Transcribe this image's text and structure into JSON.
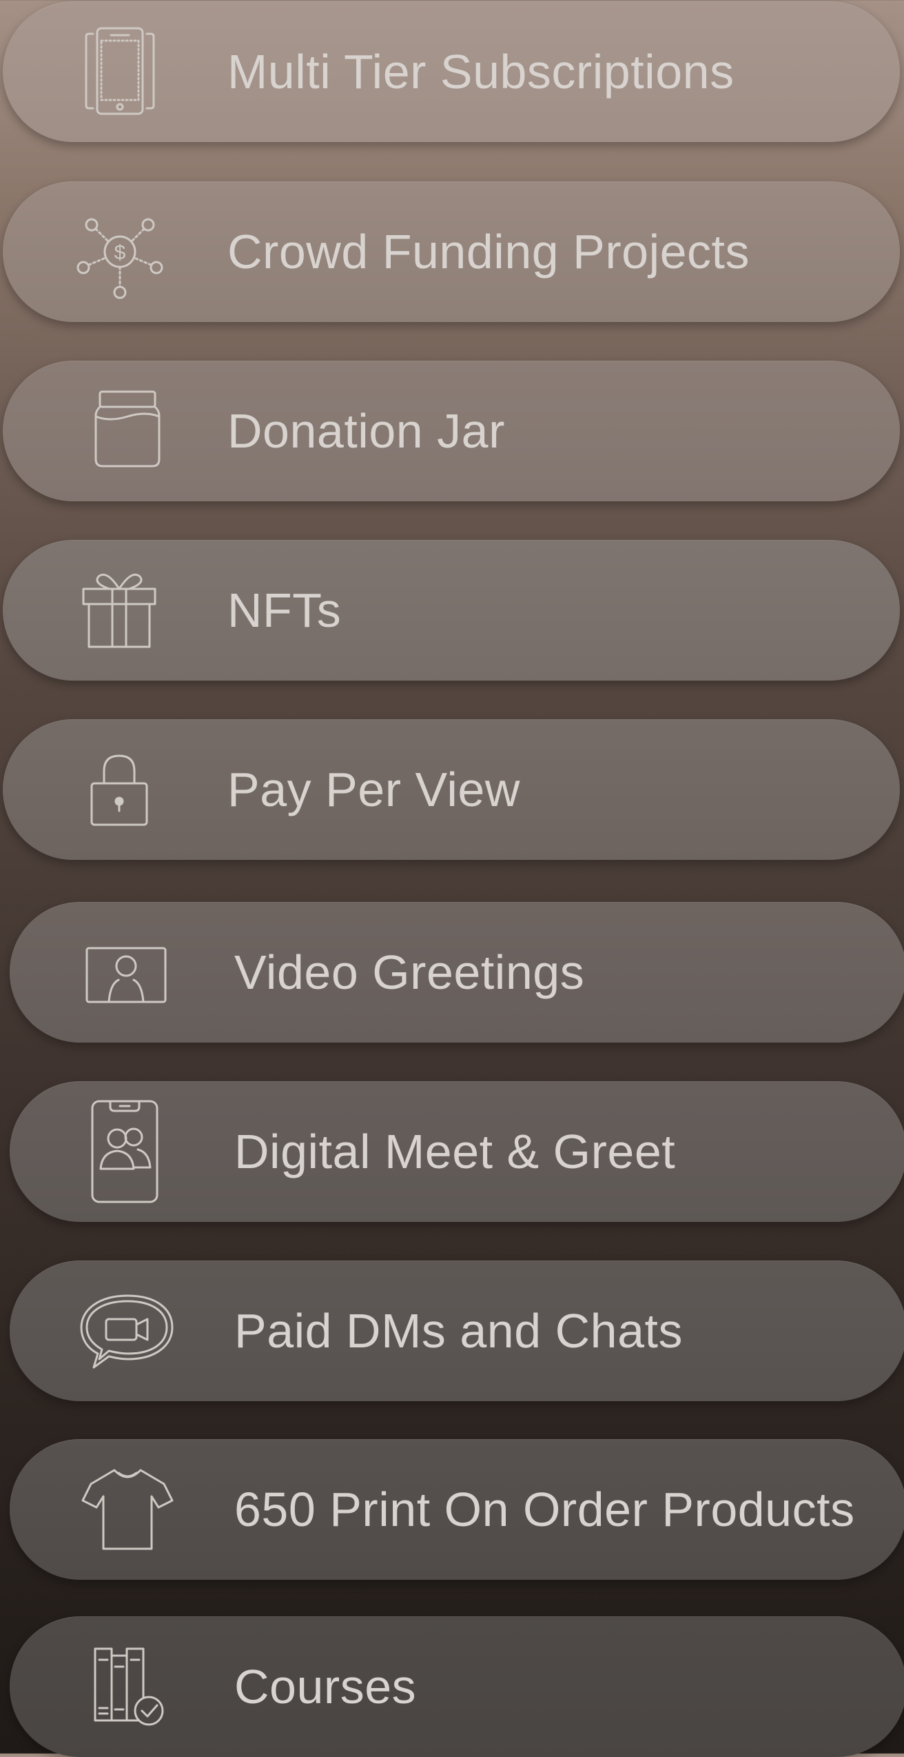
{
  "items": [
    {
      "label": "Multi Tier Subscriptions",
      "icon": "tablet-icon",
      "bg": "#a2928a"
    },
    {
      "label": "Crowd Funding Projects",
      "icon": "crowdfunding-network-icon",
      "bg": "#938379"
    },
    {
      "label": "Donation Jar",
      "icon": "jar-icon",
      "bg": "#857771"
    },
    {
      "label": "NFTs",
      "icon": "gift-icon",
      "bg": "#7a6f6a"
    },
    {
      "label": "Pay Per View",
      "icon": "lock-icon",
      "bg": "#716863"
    },
    {
      "label": "Video Greetings",
      "icon": "video-person-icon",
      "bg": "#6b625e"
    },
    {
      "label": "Digital Meet & Greet",
      "icon": "phone-people-icon",
      "bg": "#625b58"
    },
    {
      "label": "Paid DMs and Chats",
      "icon": "chat-video-icon",
      "bg": "#5b5452"
    },
    {
      "label": "650 Print On Order Products",
      "icon": "tshirt-icon",
      "bg": "#544e4c"
    },
    {
      "label": "Courses",
      "icon": "books-check-icon",
      "bg": "#4c4745"
    }
  ]
}
